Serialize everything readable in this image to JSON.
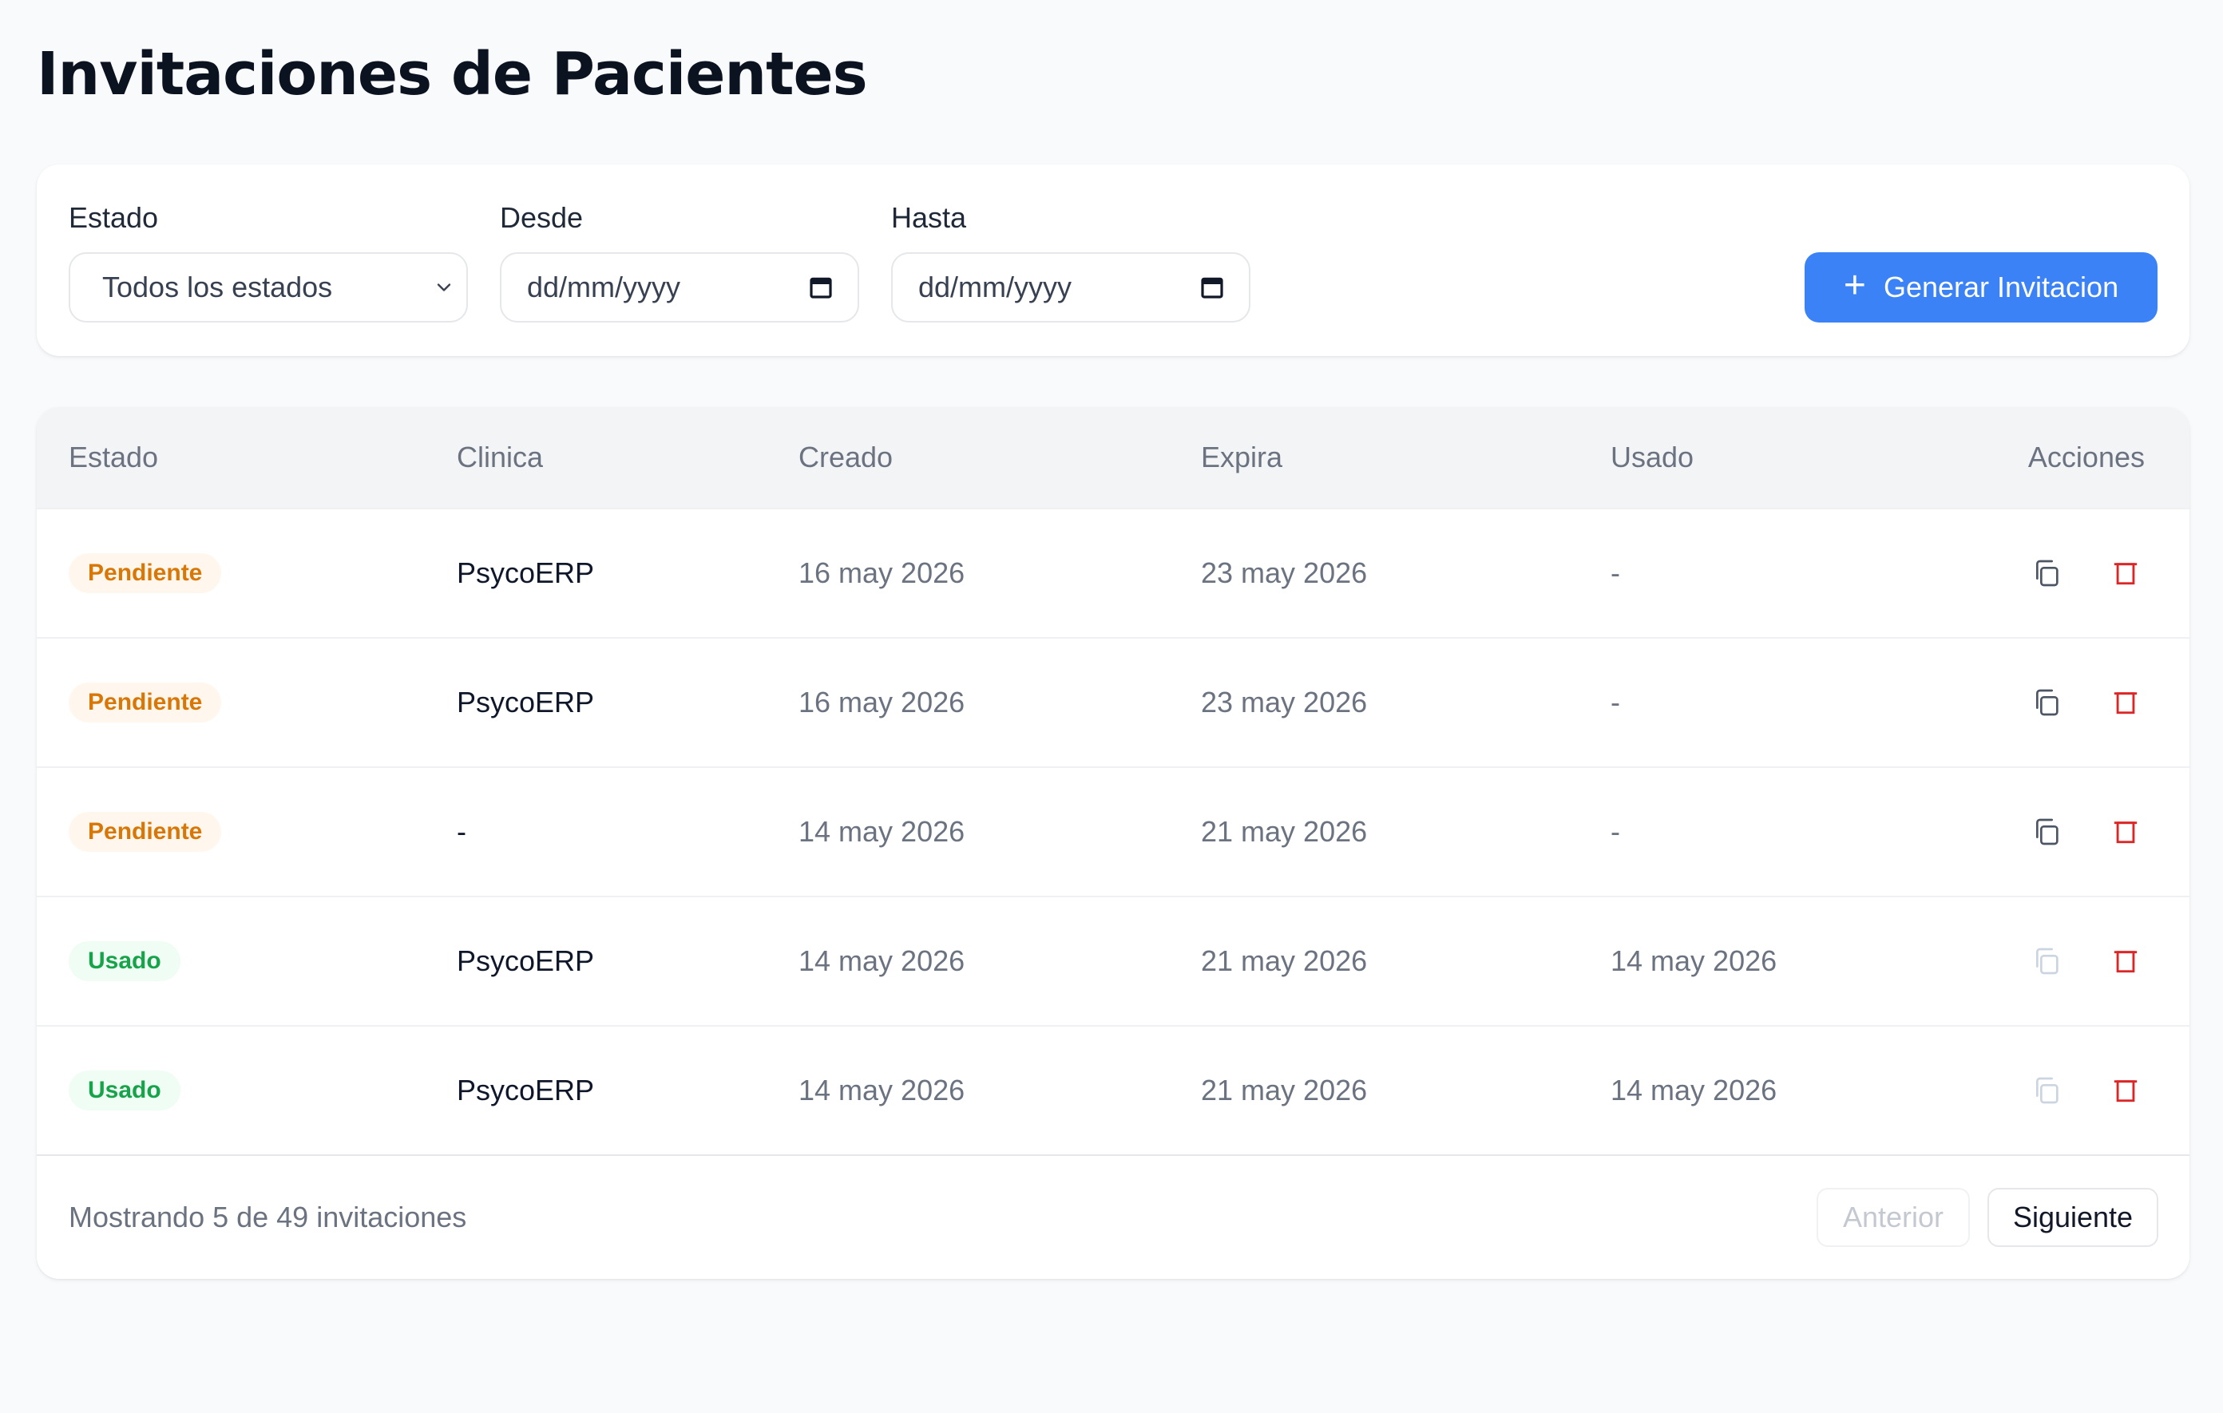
{
  "page": {
    "title": "Invitaciones de Pacientes"
  },
  "filters": {
    "estado_label": "Estado",
    "estado_value": "Todos los estados",
    "desde_label": "Desde",
    "desde_placeholder": "dd/mm/yyyy",
    "hasta_label": "Hasta",
    "hasta_placeholder": "dd/mm/yyyy",
    "generate_button_label": "Generar Invitacion",
    "generate_button_icon": "plus-icon"
  },
  "table": {
    "headers": {
      "estado": "Estado",
      "clinica": "Clinica",
      "creado": "Creado",
      "expira": "Expira",
      "usado": "Usado",
      "acciones": "Acciones"
    },
    "rows": [
      {
        "estado": "Pendiente",
        "status": "pending",
        "clinica": "PsycoERP",
        "creado": "16 may 2026",
        "expira": "23 may 2026",
        "usado": "-",
        "copy_enabled": true
      },
      {
        "estado": "Pendiente",
        "status": "pending",
        "clinica": "PsycoERP",
        "creado": "16 may 2026",
        "expira": "23 may 2026",
        "usado": "-",
        "copy_enabled": true
      },
      {
        "estado": "Pendiente",
        "status": "pending",
        "clinica": "-",
        "creado": "14 may 2026",
        "expira": "21 may 2026",
        "usado": "-",
        "copy_enabled": true
      },
      {
        "estado": "Usado",
        "status": "used",
        "clinica": "PsycoERP",
        "creado": "14 may 2026",
        "expira": "21 may 2026",
        "usado": "14 may 2026",
        "copy_enabled": false
      },
      {
        "estado": "Usado",
        "status": "used",
        "clinica": "PsycoERP",
        "creado": "14 may 2026",
        "expira": "21 may 2026",
        "usado": "14 may 2026",
        "copy_enabled": false
      }
    ],
    "action_icons": [
      "copy-icon",
      "trash-icon"
    ]
  },
  "footer": {
    "summary": "Mostrando 5 de 49 invitaciones",
    "prev_label": "Anterior",
    "next_label": "Siguiente",
    "prev_enabled": false,
    "next_enabled": true
  },
  "colors": {
    "primary": "#3b82f6",
    "pending_text": "#d97706",
    "pending_bg": "#fff7ed",
    "used_text": "#16a34a",
    "used_bg": "#f0fdf4",
    "danger": "#dc2626",
    "page_bg": "#f8fafc"
  }
}
